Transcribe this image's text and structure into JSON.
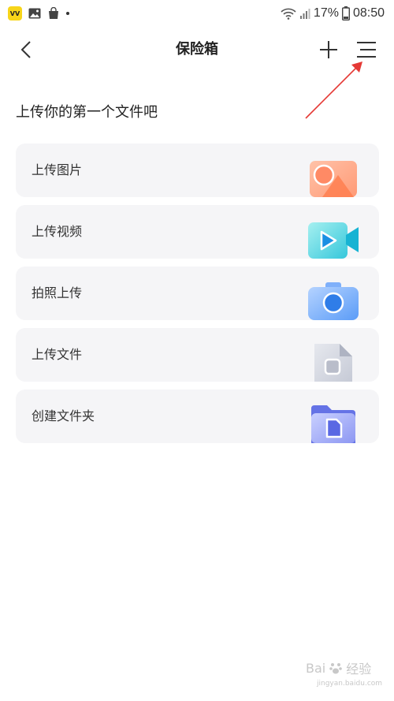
{
  "status_bar": {
    "app_badge": "VV",
    "battery_percent": "17%",
    "time": "08:50"
  },
  "nav": {
    "title": "保险箱"
  },
  "section": {
    "title": "上传你的第一个文件吧"
  },
  "upload_items": [
    {
      "label": "上传图片",
      "icon": "image-icon"
    },
    {
      "label": "上传视频",
      "icon": "video-icon"
    },
    {
      "label": "拍照上传",
      "icon": "camera-icon"
    },
    {
      "label": "上传文件",
      "icon": "file-icon"
    },
    {
      "label": "创建文件夹",
      "icon": "folder-icon"
    }
  ],
  "watermark": {
    "brand": "Bai",
    "suffix": "经验",
    "url": "jingyan.baidu.com"
  },
  "colors": {
    "card_bg": "#f5f5f7",
    "annotation": "#e53935"
  }
}
